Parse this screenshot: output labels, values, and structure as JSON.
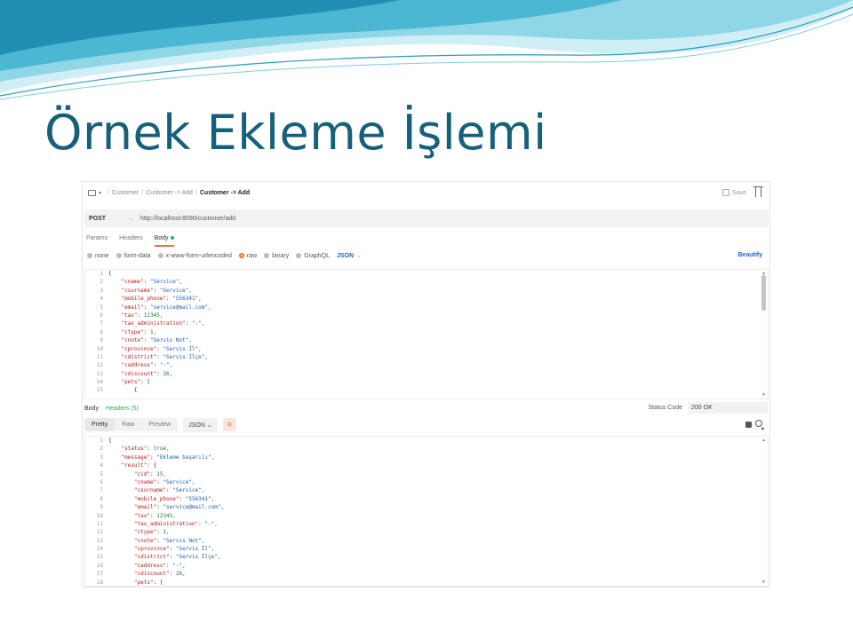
{
  "slide": {
    "title": "Örnek Ekleme İşlemi"
  },
  "breadcrumb": {
    "items": [
      "Customer",
      "Customer -> Add",
      "Customer -> Add"
    ]
  },
  "toolbar": {
    "save_label": "Save"
  },
  "request": {
    "method": "POST",
    "url": "http://localhost:8090/customer/add",
    "tabs": [
      "Params",
      "Headers",
      "Body"
    ],
    "active_tab": "Body",
    "body_types": [
      "none",
      "form-data",
      "x-www-form-urlencoded",
      "raw",
      "binary",
      "GraphQL"
    ],
    "selected_type": "raw",
    "format": "JSON",
    "beautify_label": "Beautify",
    "lines": [
      {
        "num": "1",
        "text": "{"
      },
      {
        "num": "2",
        "text": "    \"cname\": \"Service\","
      },
      {
        "num": "3",
        "text": "    \"csurname\": \"Service\","
      },
      {
        "num": "4",
        "text": "    \"mobile_phone\": \"556341\","
      },
      {
        "num": "5",
        "text": "    \"email\": \"service@mail.com\","
      },
      {
        "num": "6",
        "text": "    \"tax\": 12345,"
      },
      {
        "num": "7",
        "text": "    \"tax_administration\": \"-\","
      },
      {
        "num": "8",
        "text": "    \"ctype\": 1,"
      },
      {
        "num": "9",
        "text": "    \"cnote\": \"Servis Not\","
      },
      {
        "num": "10",
        "text": "    \"cprovince\": \"Servis İl\","
      },
      {
        "num": "11",
        "text": "    \"cdistrict\": \"Servis İlçe\","
      },
      {
        "num": "12",
        "text": "    \"caddress\": \"-\","
      },
      {
        "num": "13",
        "text": "    \"cdiscount\": 26,"
      },
      {
        "num": "14",
        "text": "    \"pets\": ["
      },
      {
        "num": "15",
        "text": "        {"
      }
    ]
  },
  "response": {
    "tabs": [
      "Body",
      "Headers (5)"
    ],
    "status_label": "Status Code",
    "status_value": "200 OK",
    "view_tools": [
      "Pretty",
      "Raw",
      "Preview"
    ],
    "format": "JSON",
    "lines": [
      {
        "num": "1",
        "text": "{"
      },
      {
        "num": "2",
        "text": "    \"status\": true,"
      },
      {
        "num": "3",
        "text": "    \"message\": \"Ekleme başarılı\","
      },
      {
        "num": "4",
        "text": "    \"result\": {"
      },
      {
        "num": "5",
        "text": "        \"cid\": 15,"
      },
      {
        "num": "6",
        "text": "        \"cname\": \"Service\","
      },
      {
        "num": "7",
        "text": "        \"csurname\": \"Service\","
      },
      {
        "num": "8",
        "text": "        \"mobile_phone\": \"556341\","
      },
      {
        "num": "9",
        "text": "        \"email\": \"service@mail.com\","
      },
      {
        "num": "10",
        "text": "        \"tax\": 12345,"
      },
      {
        "num": "11",
        "text": "        \"tax_administration\": \"-\","
      },
      {
        "num": "12",
        "text": "        \"ctype\": 1,"
      },
      {
        "num": "13",
        "text": "        \"cnote\": \"Servis Not\","
      },
      {
        "num": "14",
        "text": "        \"cprovince\": \"Servis İl\","
      },
      {
        "num": "15",
        "text": "        \"cdistrict\": \"Servis İlçe\","
      },
      {
        "num": "16",
        "text": "        \"caddress\": \"-\","
      },
      {
        "num": "17",
        "text": "        \"cdiscount\": 26,"
      },
      {
        "num": "18",
        "text": "        \"pets\": ["
      }
    ]
  },
  "colors": {
    "title": "#17607a",
    "accent": "#f26b3a",
    "link": "#1d62c7",
    "wave": "#3aaecb"
  }
}
